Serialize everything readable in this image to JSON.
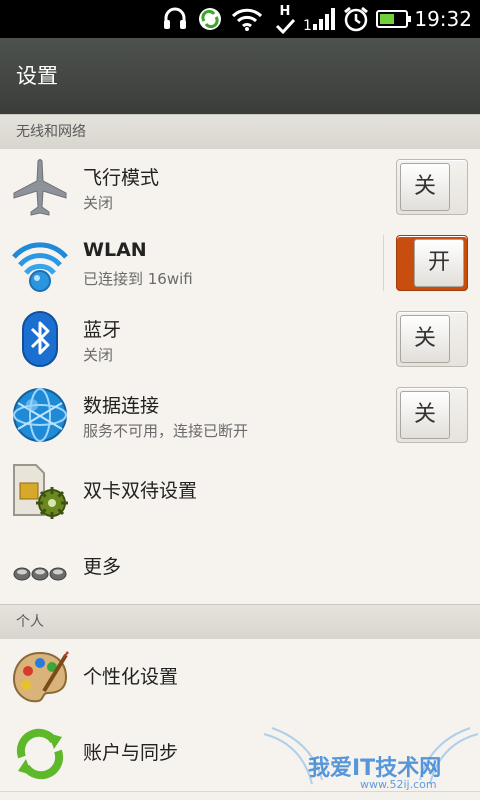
{
  "status_bar": {
    "time": "19:32",
    "signal_type": "H",
    "icons": [
      "headset-icon",
      "sync-icon",
      "wifi-icon",
      "h-data-icon",
      "signal-icon",
      "alarm-icon",
      "battery-icon"
    ]
  },
  "title_bar": {
    "title": "设置"
  },
  "sections": {
    "wireless": "无线和网络",
    "personal": "个人"
  },
  "rows": {
    "airplane": {
      "title": "飞行模式",
      "subtitle": "关闭",
      "toggle": "关",
      "state": "off"
    },
    "wlan": {
      "title": "WLAN",
      "subtitle": "已连接到 16wifi",
      "toggle": "开",
      "state": "on"
    },
    "bluetooth": {
      "title": "蓝牙",
      "subtitle": "关闭",
      "toggle": "关",
      "state": "off"
    },
    "data": {
      "title": "数据连接",
      "subtitle": "服务不可用，连接已断开",
      "toggle": "关",
      "state": "off"
    },
    "dual_sim": {
      "title": "双卡双待设置"
    },
    "more": {
      "title": "更多"
    },
    "personalize": {
      "title": "个性化设置"
    },
    "accounts": {
      "title": "账户与同步"
    }
  },
  "watermark": {
    "text": "我爱IT技术网",
    "url": "www.52ij.com"
  },
  "colors": {
    "toggle_on": "#c84e10",
    "title_bar": "#464a46",
    "background": "#f6f3ee"
  }
}
